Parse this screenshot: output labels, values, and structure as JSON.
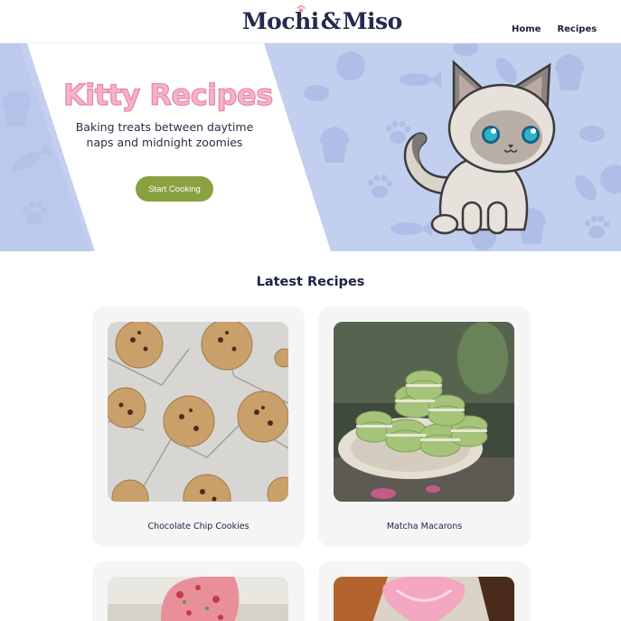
{
  "header": {
    "logo_part1": "Mochi",
    "logo_amp": "&",
    "logo_part2": "Miso",
    "nav": [
      "Home",
      "Recipes"
    ]
  },
  "hero": {
    "title": "Kitty Recipes",
    "subtitle_line1": "Baking treats between daytime",
    "subtitle_line2": "naps and midnight zoomies",
    "button": "Start Cooking",
    "colors": {
      "bg": "#c3cfee",
      "title": "#f6b3c6",
      "button": "#8aa142"
    }
  },
  "latest": {
    "title": "Latest Recipes",
    "cards": [
      {
        "name": "Chocolate Chip Cookies"
      },
      {
        "name": "Matcha Macarons"
      },
      {
        "name": ""
      },
      {
        "name": ""
      }
    ]
  }
}
